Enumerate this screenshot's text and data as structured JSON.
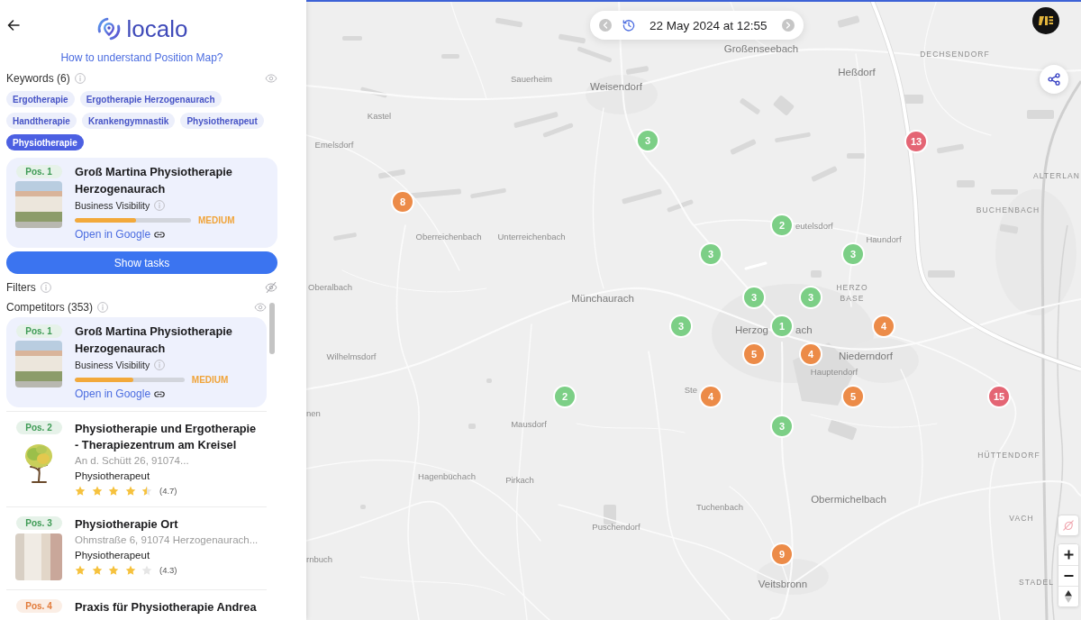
{
  "header": {
    "logo": "localo",
    "help_link": "How to understand Position Map?"
  },
  "keywords": {
    "label": "Keywords (6)",
    "visible": true,
    "items": [
      {
        "label": "Ergotherapie",
        "selected": false
      },
      {
        "label": "Ergotherapie Herzogenaurach",
        "selected": false
      },
      {
        "label": "Handtherapie",
        "selected": false
      },
      {
        "label": "Krankengymnastik",
        "selected": false
      },
      {
        "label": "Physiotherapeut",
        "selected": false
      },
      {
        "label": "Physiotherapie",
        "selected": true
      }
    ]
  },
  "business": {
    "position": "Pos. 1",
    "color": "#3e9b55",
    "name": "Groß Martina Physiotherapie Herzogenaurach",
    "visibility_label": "Business Visibility",
    "level": 0.53,
    "visibility_rating": "MEDIUM",
    "link": "Open in Google"
  },
  "show_tasks": "Show tasks",
  "filters": {
    "label": "Filters",
    "visible": false
  },
  "competitors": {
    "label": "Competitors (353)",
    "visible": true,
    "items": [
      {
        "kind": "business",
        "position": "Pos. 1",
        "color": "#3e9b55",
        "name": "Groß Martina Physiotherapie Herzogenaurach",
        "visibility_label": "Business Visibility",
        "level": 0.53,
        "visibility_rating": "MEDIUM",
        "link": "Open in Google"
      },
      {
        "kind": "listing",
        "position": "Pos. 2",
        "color": "#3e9b55",
        "name": "Physiotherapie und Ergotherapie - Therapiezentrum am Kreisel",
        "address": "An d. Schütt 26, 91074...",
        "category": "Physiotherapeut",
        "stars": 4.5,
        "rating": "(4.7)"
      },
      {
        "kind": "listing",
        "position": "Pos. 3",
        "color": "#3e9b55",
        "name": "Physiotherapie Ort",
        "address": "Ohmstraße 6, 91074 Herzogenaurach...",
        "category": "Physiotherapeut",
        "stars": 4,
        "rating": "(4.3)"
      },
      {
        "kind": "listing",
        "position": "Pos. 4",
        "color": "#e27b3a",
        "name": "Praxis für Physiotherapie Andrea"
      }
    ]
  },
  "map": {
    "date": "22 May 2024 at 12:55",
    "places": [
      {
        "name": "Großenseebach"
      },
      {
        "name": "DECHSENDORF"
      },
      {
        "name": "Heßdorf"
      },
      {
        "name": "Sauerheim"
      },
      {
        "name": "Weisendorf"
      },
      {
        "name": "Kastel"
      },
      {
        "name": "Emelsdorf"
      },
      {
        "name": "ALTERLAN"
      },
      {
        "name": "BUCHENBACH"
      },
      {
        "name": "eutelsdorf"
      },
      {
        "name": "Oberreichenbach"
      },
      {
        "name": "Unterreichenbach"
      },
      {
        "name": "Haundorf"
      },
      {
        "name": "Oberalbach"
      },
      {
        "name": "HERZO"
      },
      {
        "name": "BASE"
      },
      {
        "name": "Münchaurach"
      },
      {
        "name": "Herzog"
      },
      {
        "name": "ach"
      },
      {
        "name": "Wilhelmsdorf"
      },
      {
        "name": "Niederndorf"
      },
      {
        "name": "Hauptendorf"
      },
      {
        "name": "Ste"
      },
      {
        "name": "nen"
      },
      {
        "name": "Mausdorf"
      },
      {
        "name": "HÜTTENDORF"
      },
      {
        "name": "Hagenbüchach"
      },
      {
        "name": "Pirkach"
      },
      {
        "name": "Obermichelbach"
      },
      {
        "name": "Tuchenbach"
      },
      {
        "name": "VACH"
      },
      {
        "name": "Puschendorf"
      },
      {
        "name": "rnbuch"
      },
      {
        "name": "STADEL"
      },
      {
        "name": "Veitsbronn"
      }
    ],
    "markers": [
      {
        "value": "3",
        "color": "#7ccf86"
      },
      {
        "value": "13",
        "color": "#e46574"
      },
      {
        "value": "8",
        "color": "#ec8b48"
      },
      {
        "value": "2",
        "color": "#7ccf86"
      },
      {
        "value": "3",
        "color": "#7ccf86"
      },
      {
        "value": "3",
        "color": "#7ccf86"
      },
      {
        "value": "3",
        "color": "#7ccf86"
      },
      {
        "value": "3",
        "color": "#7ccf86"
      },
      {
        "value": "3",
        "color": "#7ccf86"
      },
      {
        "value": "1",
        "color": "#7ccf86"
      },
      {
        "value": "4",
        "color": "#ec8b48"
      },
      {
        "value": "5",
        "color": "#ec8b48"
      },
      {
        "value": "4",
        "color": "#ec8b48"
      },
      {
        "value": "2",
        "color": "#7ccf86"
      },
      {
        "value": "4",
        "color": "#ec8b48"
      },
      {
        "value": "5",
        "color": "#ec8b48"
      },
      {
        "value": "15",
        "color": "#e46574"
      },
      {
        "value": "3",
        "color": "#7ccf86"
      },
      {
        "value": "9",
        "color": "#ec8b48"
      }
    ]
  }
}
